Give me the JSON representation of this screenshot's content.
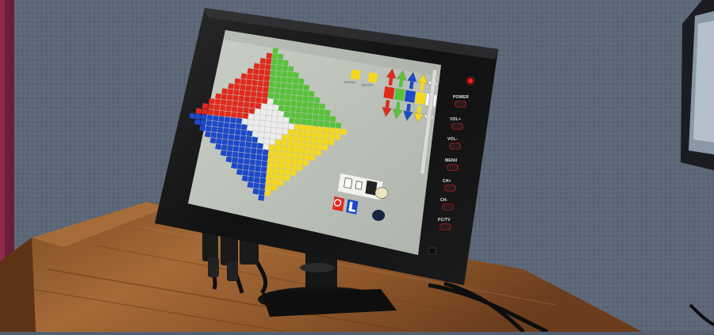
{
  "photo": {
    "subject": "touchscreen-monitor-on-wooden-desk"
  },
  "monitor": {
    "buttons": [
      {
        "label": "POWER",
        "icon": "power-button"
      },
      {
        "label": "VOL+",
        "icon": "volume-up-button"
      },
      {
        "label": "VOL-",
        "icon": "volume-down-button"
      },
      {
        "label": "MENU",
        "icon": "menu-button"
      },
      {
        "label": "CH+",
        "icon": "channel-up-button"
      },
      {
        "label": "CH-",
        "icon": "channel-down-button"
      },
      {
        "label": "PC/TV",
        "icon": "source-button"
      }
    ],
    "power_led_color": "#ff2020"
  },
  "screen_app": {
    "color_wheel": {
      "segments": [
        {
          "color": "red",
          "hex": "#e02a1c"
        },
        {
          "color": "green",
          "hex": "#58c23a"
        },
        {
          "color": "blue",
          "hex": "#1d48c8"
        },
        {
          "color": "yellow",
          "hex": "#f4d81e"
        },
        {
          "color": "white",
          "hex": "#ececec"
        }
      ]
    },
    "swatch_labels": [
      "Selected",
      "Selected"
    ],
    "arrow_palette": {
      "colors": [
        "#e02a1c",
        "#58c23a",
        "#1d48c8",
        "#f4d81e",
        "#ffffff"
      ],
      "up_icon": "arrow-up-icon",
      "down_icon": "arrow-down-icon"
    },
    "tool_palette": {
      "icons": [
        "empty-square-icon",
        "small-square-icon",
        "pattern-icon",
        "circle-light-icon",
        "stop-icon",
        "l-block-icon",
        "circle-dark-icon"
      ]
    }
  }
}
